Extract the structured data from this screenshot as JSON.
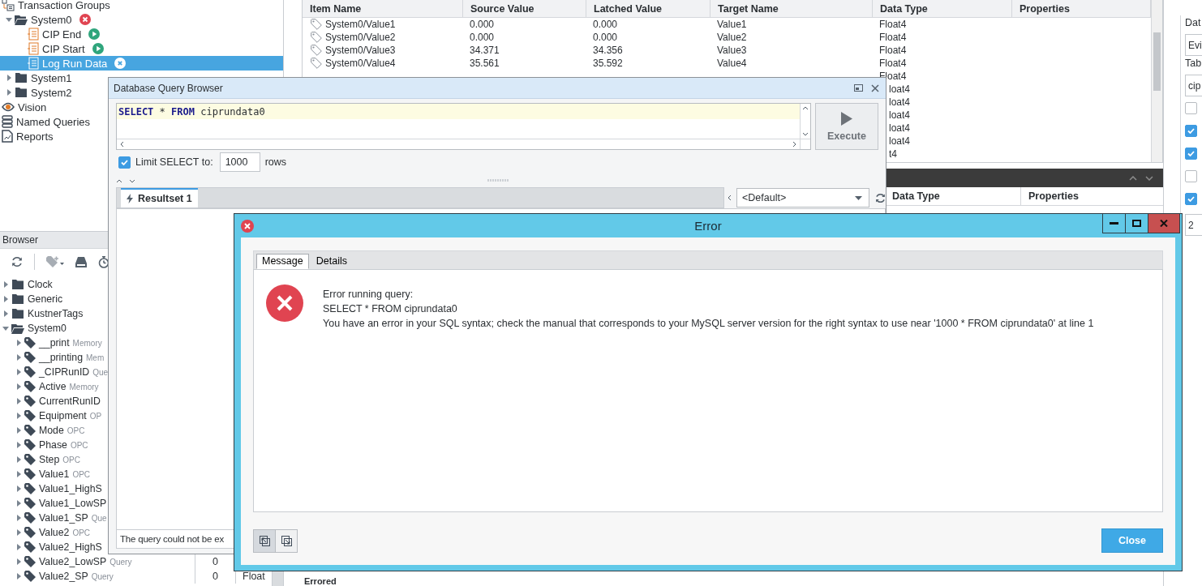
{
  "project_tree": [
    {
      "label": "Transaction Groups",
      "kind": "group",
      "selected": false,
      "children": [
        {
          "label": "System0",
          "kind": "folder",
          "expanded": true,
          "badge": {
            "kind": "error"
          },
          "selected": false,
          "children": [
            {
              "label": "CIP End",
              "kind": "transaction",
              "badge": {
                "kind": "running"
              },
              "selected": false
            },
            {
              "label": "CIP Start",
              "kind": "transaction",
              "badge": {
                "kind": "running"
              },
              "selected": false
            },
            {
              "label": "Log Run Data",
              "kind": "transaction",
              "badge": {
                "kind": "stopped"
              },
              "selected": true
            }
          ]
        },
        {
          "label": "System1",
          "kind": "folder",
          "expanded": false,
          "selected": false
        },
        {
          "label": "System2",
          "kind": "folder",
          "expanded": false,
          "selected": false
        }
      ]
    },
    {
      "label": "Vision",
      "kind": "vision",
      "selected": false
    },
    {
      "label": "Named Queries",
      "kind": "queries",
      "selected": false
    },
    {
      "label": "Reports",
      "kind": "reports",
      "selected": false
    }
  ],
  "browser": {
    "title": "Browser",
    "tags": [
      {
        "label": "Clock",
        "kind": "folder",
        "expanded": false
      },
      {
        "label": "Generic",
        "kind": "folder",
        "expanded": false
      },
      {
        "label": "KustnerTags",
        "kind": "folder",
        "expanded": false
      },
      {
        "label": "System0",
        "kind": "folder",
        "expanded": true,
        "children": [
          {
            "label": "__print",
            "kind": "tag",
            "type": "Memory",
            "expanded": false
          },
          {
            "label": "__printing",
            "kind": "tag",
            "type": "Mem",
            "expanded": false
          },
          {
            "label": "_CIPRunID",
            "kind": "tag",
            "type": "Que",
            "expanded": false
          },
          {
            "label": "Active",
            "kind": "tag",
            "type": "Memory",
            "expanded": false
          },
          {
            "label": "CurrentRunID",
            "kind": "tag",
            "expanded": false
          },
          {
            "label": "Equipment",
            "kind": "tag",
            "type": "OP",
            "expanded": false
          },
          {
            "label": "Mode",
            "kind": "tag",
            "type": "OPC",
            "expanded": false
          },
          {
            "label": "Phase",
            "kind": "tag",
            "type": "OPC",
            "expanded": false
          },
          {
            "label": "Step",
            "kind": "tag",
            "type": "OPC",
            "expanded": false
          },
          {
            "label": "Value1",
            "kind": "tag",
            "type": "OPC",
            "expanded": false
          },
          {
            "label": "Value1_HighS",
            "kind": "tag",
            "expanded": false
          },
          {
            "label": "Value1_LowSP",
            "kind": "tag",
            "expanded": false
          },
          {
            "label": "Value1_SP",
            "kind": "tag",
            "type": "Que",
            "expanded": false
          },
          {
            "label": "Value2",
            "kind": "tag",
            "type": "OPC",
            "expanded": false
          },
          {
            "label": "Value2_HighS",
            "kind": "tag",
            "expanded": false
          },
          {
            "label": "Value2_LowSP",
            "kind": "tag",
            "type": "Query",
            "value": "0",
            "expanded": false
          },
          {
            "label": "Value2_SP",
            "kind": "tag",
            "type": "Query",
            "value": "0",
            "data_type": "Float",
            "expanded": false
          }
        ]
      }
    ]
  },
  "items_table": {
    "columns": [
      "Item Name",
      "Source Value",
      "Latched Value",
      "Target Name",
      "Data Type",
      "Properties"
    ],
    "rows": [
      {
        "kind": "full",
        "cells": [
          "System0/Value1",
          "0.000",
          "0.000",
          "Value1",
          "Float4"
        ]
      },
      {
        "kind": "full",
        "cells": [
          "System0/Value2",
          "0.000",
          "0.000",
          "Value2",
          "Float4"
        ]
      },
      {
        "kind": "full",
        "cells": [
          "System0/Value3",
          "34.371",
          "34.356",
          "Value3",
          "Float4"
        ]
      },
      {
        "kind": "full",
        "cells": [
          "System0/Value4",
          "35.561",
          "35.592",
          "Value4",
          "Float4"
        ]
      },
      {
        "kind": "tail",
        "data_type": "Float4"
      },
      {
        "kind": "partial",
        "data_type": "loat4"
      },
      {
        "kind": "partial",
        "data_type": "loat4"
      },
      {
        "kind": "partial",
        "data_type": "loat4"
      },
      {
        "kind": "partial",
        "data_type": "loat4"
      },
      {
        "kind": "partial",
        "data_type": "loat4"
      },
      {
        "kind": "partial",
        "data_type": "t4"
      }
    ]
  },
  "lower_table": {
    "columns": [
      "Data Type",
      "Properties"
    ],
    "footer_label": "Errored"
  },
  "right_panel": [
    {
      "kind": "label",
      "text": "Dat"
    },
    {
      "kind": "field",
      "value": "Evi"
    },
    {
      "kind": "label",
      "text": "Tab"
    },
    {
      "kind": "field",
      "value": "cip"
    },
    {
      "kind": "checkbox",
      "checked": false
    },
    {
      "kind": "checkbox",
      "checked": true
    },
    {
      "kind": "checkbox",
      "checked": true
    },
    {
      "kind": "checkbox",
      "checked": false
    },
    {
      "kind": "checkbox",
      "checked": true
    },
    {
      "kind": "field",
      "value": "2"
    }
  ],
  "query_browser": {
    "title": "Database Query Browser",
    "query": [
      {
        "text": "SELECT",
        "kind": "keyword"
      },
      {
        "text": " * ",
        "kind": "plain"
      },
      {
        "text": "FROM",
        "kind": "keyword"
      },
      {
        "text": " ciprundata0",
        "kind": "plain"
      }
    ],
    "execute": "Execute",
    "limit": {
      "checked": true,
      "label": "Limit SELECT to:",
      "value": "1000",
      "suffix": "rows"
    },
    "tabs": [
      {
        "label": "Resultset 1",
        "selected": true
      }
    ],
    "datasource": "<Default>",
    "status": "The query could not be ex"
  },
  "error_dialog": {
    "title": "Error",
    "tabs": [
      {
        "label": "Message",
        "selected": true
      },
      {
        "label": "Details",
        "selected": false
      }
    ],
    "lines": [
      "Error running query:",
      "SELECT * FROM ciprundata0",
      "You have an error in your SQL syntax; check the manual that corresponds to your MySQL server version for the right syntax to use near '1000 * FROM ciprundata0' at line 1"
    ],
    "close": "Close"
  }
}
